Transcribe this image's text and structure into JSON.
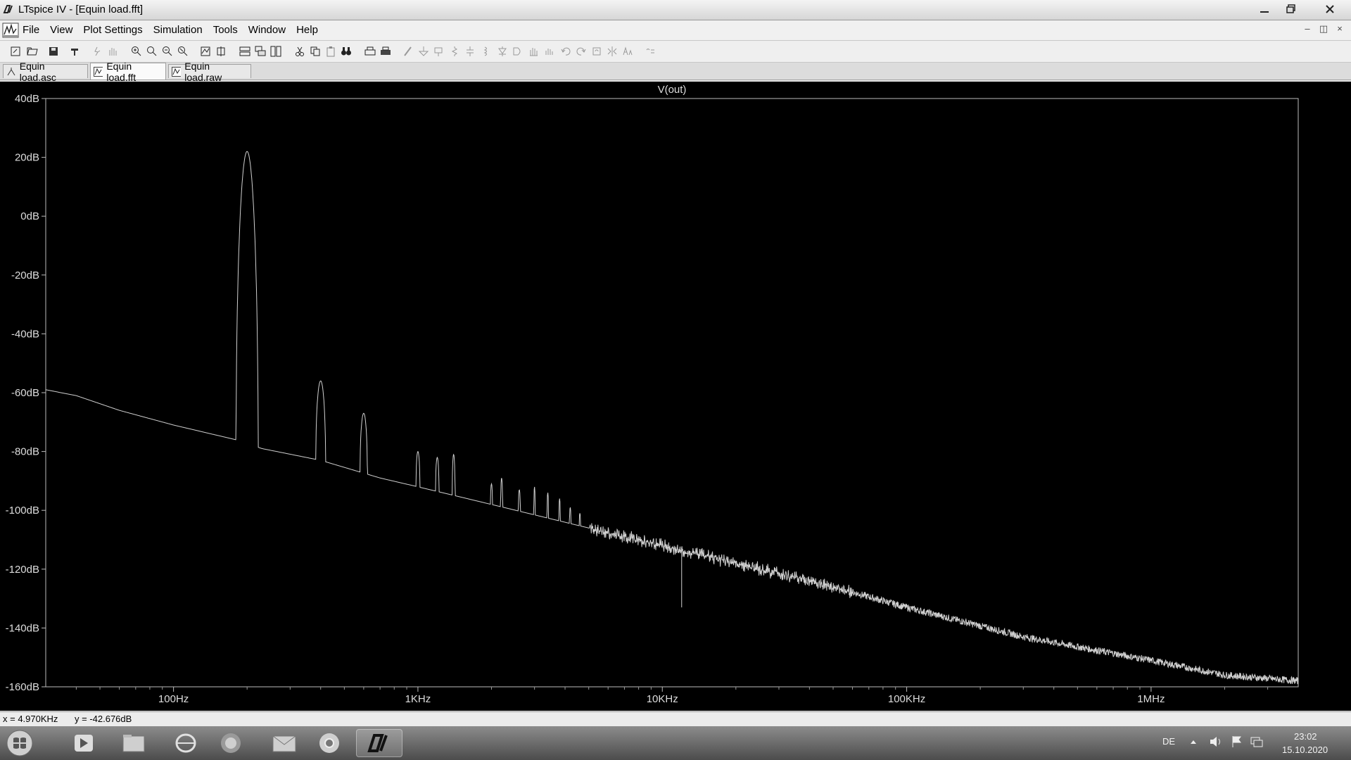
{
  "window": {
    "title": "LTspice IV - [Equin load.fft]"
  },
  "menu": [
    "File",
    "View",
    "Plot Settings",
    "Simulation",
    "Tools",
    "Window",
    "Help"
  ],
  "tabs": [
    {
      "label": "Equin load.asc"
    },
    {
      "label": "Equin load.fft"
    },
    {
      "label": "Equin load.raw"
    }
  ],
  "status": {
    "x_readout": "x = 4.970KHz",
    "y_readout": "y = -42.676dB"
  },
  "taskbar": {
    "lang": "DE",
    "time": "23:02",
    "date": "15.10.2020"
  },
  "chart_data": {
    "type": "line",
    "title": "V(out)",
    "xscale": "log",
    "xlim": [
      30,
      4000000
    ],
    "ylim": [
      -160,
      40
    ],
    "y_tick_values": [
      40,
      20,
      0,
      -20,
      -40,
      -60,
      -80,
      -100,
      -120,
      -140,
      -160
    ],
    "y_tick_labels": [
      "40dB",
      "20dB",
      "0dB",
      "-20dB",
      "-40dB",
      "-60dB",
      "-80dB",
      "-100dB",
      "-120dB",
      "-140dB",
      "-160dB"
    ],
    "x_tick_values": [
      100,
      1000,
      10000,
      100000,
      1000000
    ],
    "x_tick_labels": [
      "100Hz",
      "1KHz",
      "10KHz",
      "100KHz",
      "1MHz"
    ],
    "noise_floor": [
      [
        30,
        -59
      ],
      [
        40,
        -61
      ],
      [
        60,
        -66
      ],
      [
        100,
        -71
      ],
      [
        180,
        -76
      ],
      [
        230,
        -79
      ],
      [
        400,
        -83
      ],
      [
        700,
        -89
      ],
      [
        1000,
        -92
      ],
      [
        2000,
        -98
      ],
      [
        5000,
        -106
      ],
      [
        10000,
        -112
      ],
      [
        20000,
        -118
      ],
      [
        50000,
        -126
      ],
      [
        100000,
        -133
      ],
      [
        300000,
        -143
      ],
      [
        1000000,
        -151
      ],
      [
        2000000,
        -156
      ],
      [
        4000000,
        -158
      ]
    ],
    "peaks": [
      {
        "f": 200,
        "db": 22,
        "width": 0.045
      },
      {
        "f": 400,
        "db": -56,
        "width": 0.02
      },
      {
        "f": 600,
        "db": -67,
        "width": 0.015
      },
      {
        "f": 1000,
        "db": -80,
        "width": 0.008
      },
      {
        "f": 1200,
        "db": -82,
        "width": 0.007
      },
      {
        "f": 1400,
        "db": -81,
        "width": 0.006
      },
      {
        "f": 2000,
        "db": -91,
        "width": 0.004
      },
      {
        "f": 2200,
        "db": -89,
        "width": 0.004
      },
      {
        "f": 2600,
        "db": -93,
        "width": 0.004
      },
      {
        "f": 3000,
        "db": -92,
        "width": 0.003
      },
      {
        "f": 3400,
        "db": -94,
        "width": 0.003
      },
      {
        "f": 3800,
        "db": -96,
        "width": 0.003
      },
      {
        "f": 4200,
        "db": -99,
        "width": 0.003
      },
      {
        "f": 4600,
        "db": -101,
        "width": 0.003
      }
    ],
    "min_marker": {
      "f": 12000,
      "db": -133
    },
    "series": [
      {
        "values": []
      }
    ]
  }
}
